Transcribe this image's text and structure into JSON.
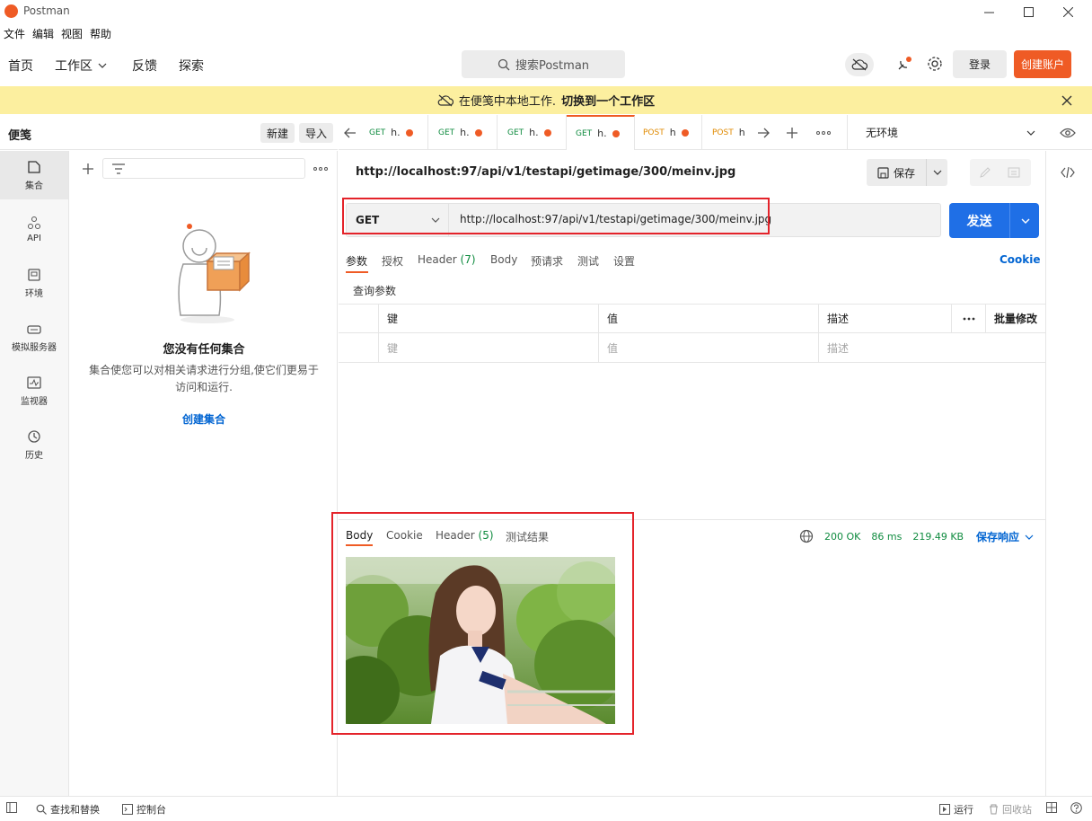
{
  "app": {
    "title": "Postman"
  },
  "menu": [
    "文件",
    "编辑",
    "视图",
    "帮助"
  ],
  "topnav": {
    "home": "首页",
    "workspace": "工作区",
    "feedback": "反馈",
    "explore": "探索",
    "search_placeholder": "搜索Postman",
    "login": "登录",
    "signup": "创建账户"
  },
  "banner": {
    "text": "在便笺中本地工作.",
    "link": "切换到一个工作区"
  },
  "sidebar": {
    "title": "便笺",
    "new_btn": "新建",
    "import_btn": "导入",
    "rail": [
      {
        "label": "集合",
        "icon": "collections-icon"
      },
      {
        "label": "API",
        "icon": "api-icon"
      },
      {
        "label": "环境",
        "icon": "environment-icon"
      },
      {
        "label": "模拟服务器",
        "icon": "mock-server-icon"
      },
      {
        "label": "监视器",
        "icon": "monitor-icon"
      },
      {
        "label": "历史",
        "icon": "history-icon"
      }
    ],
    "empty_title": "您没有任何集合",
    "empty_desc": "集合使您可以对相关请求进行分组,使它们更易于访问和运行.",
    "create_collection": "创建集合"
  },
  "tabs": [
    {
      "method": "GET",
      "name": "h."
    },
    {
      "method": "GET",
      "name": "h."
    },
    {
      "method": "GET",
      "name": "h."
    },
    {
      "method": "GET",
      "name": "h."
    },
    {
      "method": "POST",
      "name": "h"
    },
    {
      "method": "POST",
      "name": "h"
    }
  ],
  "environment": "无环境",
  "request": {
    "title": "http://localhost:97/api/v1/testapi/getimage/300/meinv.jpg",
    "save": "保存",
    "method": "GET",
    "url": "http://localhost:97/api/v1/testapi/getimage/300/meinv.jpg",
    "send": "发送",
    "tabs": {
      "params": "参数",
      "auth": "授权",
      "header": "Header",
      "header_count": "(7)",
      "body": "Body",
      "prerequest": "预请求",
      "tests": "测试",
      "settings": "设置"
    },
    "cookie": "Cookie",
    "query_title": "查询参数",
    "table": {
      "headers": {
        "key": "键",
        "value": "值",
        "desc": "描述",
        "bulk": "批量修改"
      },
      "placeholders": {
        "key": "键",
        "value": "值",
        "desc": "描述"
      }
    }
  },
  "response": {
    "tabs": {
      "body": "Body",
      "cookie": "Cookie",
      "header": "Header",
      "header_count": "(5)",
      "tests": "测试结果"
    },
    "status": "200 OK",
    "time": "86 ms",
    "size": "219.49 KB",
    "save": "保存响应"
  },
  "footer": {
    "find": "查找和替换",
    "console": "控制台",
    "runner": "运行",
    "trash": "回收站"
  },
  "colors": {
    "accent": "#ef5b25",
    "send": "#1f6fe6",
    "link": "#0265d2",
    "banner": "#fcef9f",
    "highlight": "#e4232a"
  }
}
